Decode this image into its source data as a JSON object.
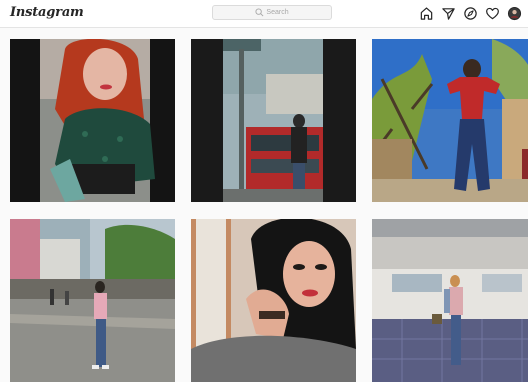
{
  "app": {
    "name": "Instagram"
  },
  "header": {
    "logo_text": "Instagram",
    "search": {
      "placeholder": "Search",
      "icon": "search-icon"
    },
    "nav_icons": [
      "home-icon",
      "direct-icon",
      "explore-icon",
      "activity-icon",
      "profile-avatar"
    ]
  },
  "grid": {
    "posts": [
      {
        "alt": "",
        "palette": "red-hair-selfie"
      },
      {
        "alt": "",
        "palette": "street-bus"
      },
      {
        "alt": "",
        "palette": "tree-sky"
      },
      {
        "alt": "",
        "palette": "city-street"
      },
      {
        "alt": "",
        "palette": "closeup-selfie"
      },
      {
        "alt": "",
        "palette": "mall-interior"
      }
    ]
  },
  "colors": {
    "background": "#fafafa",
    "header_bg": "#ffffff",
    "border": "#dbdbdb",
    "text": "#262626"
  }
}
